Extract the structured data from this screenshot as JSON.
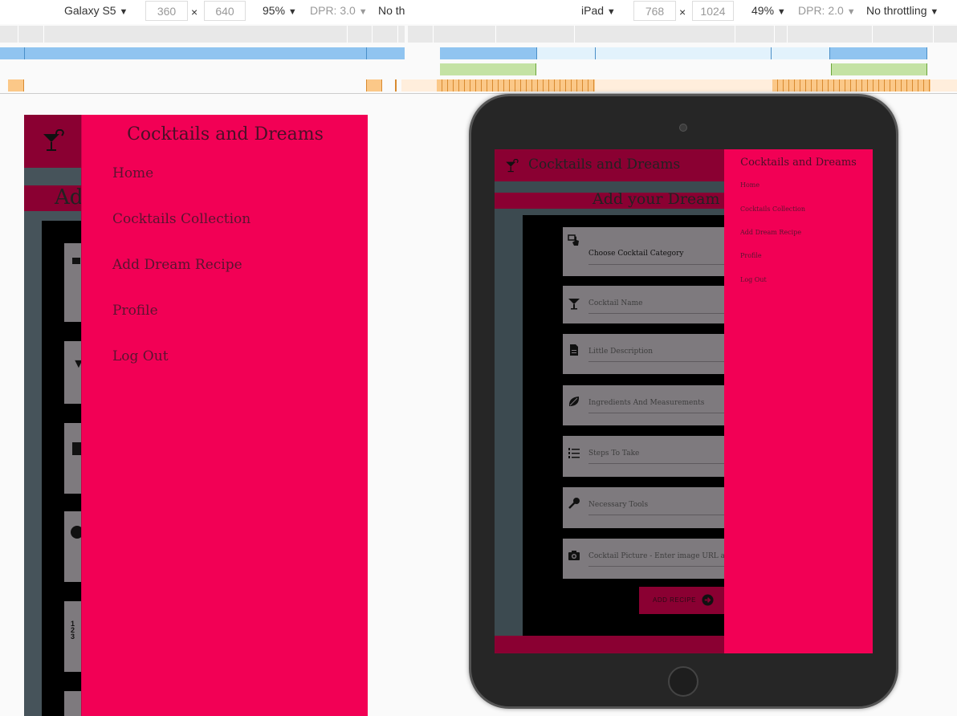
{
  "toolbar": {
    "left_device": "Galaxy S5",
    "left_width": "360",
    "left_height": "640",
    "left_zoom": "95%",
    "left_dpr": "DPR: 3.0",
    "left_throttle": "No th",
    "right_device": "iPad",
    "right_width": "768",
    "right_height": "1024",
    "right_zoom": "49%",
    "right_dpr": "DPR: 2.0",
    "right_throttle": "No throttling",
    "dropdown_glyph": "▼",
    "times": "×"
  },
  "galaxy": {
    "page_heading_fragment": "Ad",
    "drawer": {
      "title": "Cocktails and Dreams",
      "items": [
        "Home",
        "Cocktails Collection",
        "Add Dream Recipe",
        "Profile",
        "Log Out"
      ]
    }
  },
  "ipad": {
    "brand": "Cocktails and Dreams",
    "page_heading": "Add your Dream",
    "drawer": {
      "title": "Cocktails and Dreams",
      "items": [
        "Home",
        "Cocktails Collection",
        "Add Dream Recipe",
        "Profile",
        "Log Out"
      ]
    },
    "form": {
      "fields": [
        {
          "label": "Choose Cocktail Category",
          "icon": "cocktail-category-icon"
        },
        {
          "label": "Cocktail Name",
          "icon": "martini-glass-icon"
        },
        {
          "label": "Little Description",
          "icon": "document-icon"
        },
        {
          "label": "Ingredients And Measurements",
          "icon": "lime-leaf-icon"
        },
        {
          "label": "Steps To Take",
          "icon": "numbered-list-icon"
        },
        {
          "label": "Necessary Tools",
          "icon": "spoon-icon"
        },
        {
          "label": "Cocktail Picture - Enter image URL address",
          "icon": "camera-icon"
        }
      ],
      "submit_label": "ADD RECIPE"
    }
  },
  "colors": {
    "accent": "#f20055",
    "header_dark": "#8a0032",
    "page_bg": "#46535a",
    "form_bg": "#000000",
    "field_bg": "#7e7a7e",
    "mq_blue": "#90c4f0",
    "mq_green": "#c4e2a4",
    "mq_orange": "#ffe6c8"
  }
}
